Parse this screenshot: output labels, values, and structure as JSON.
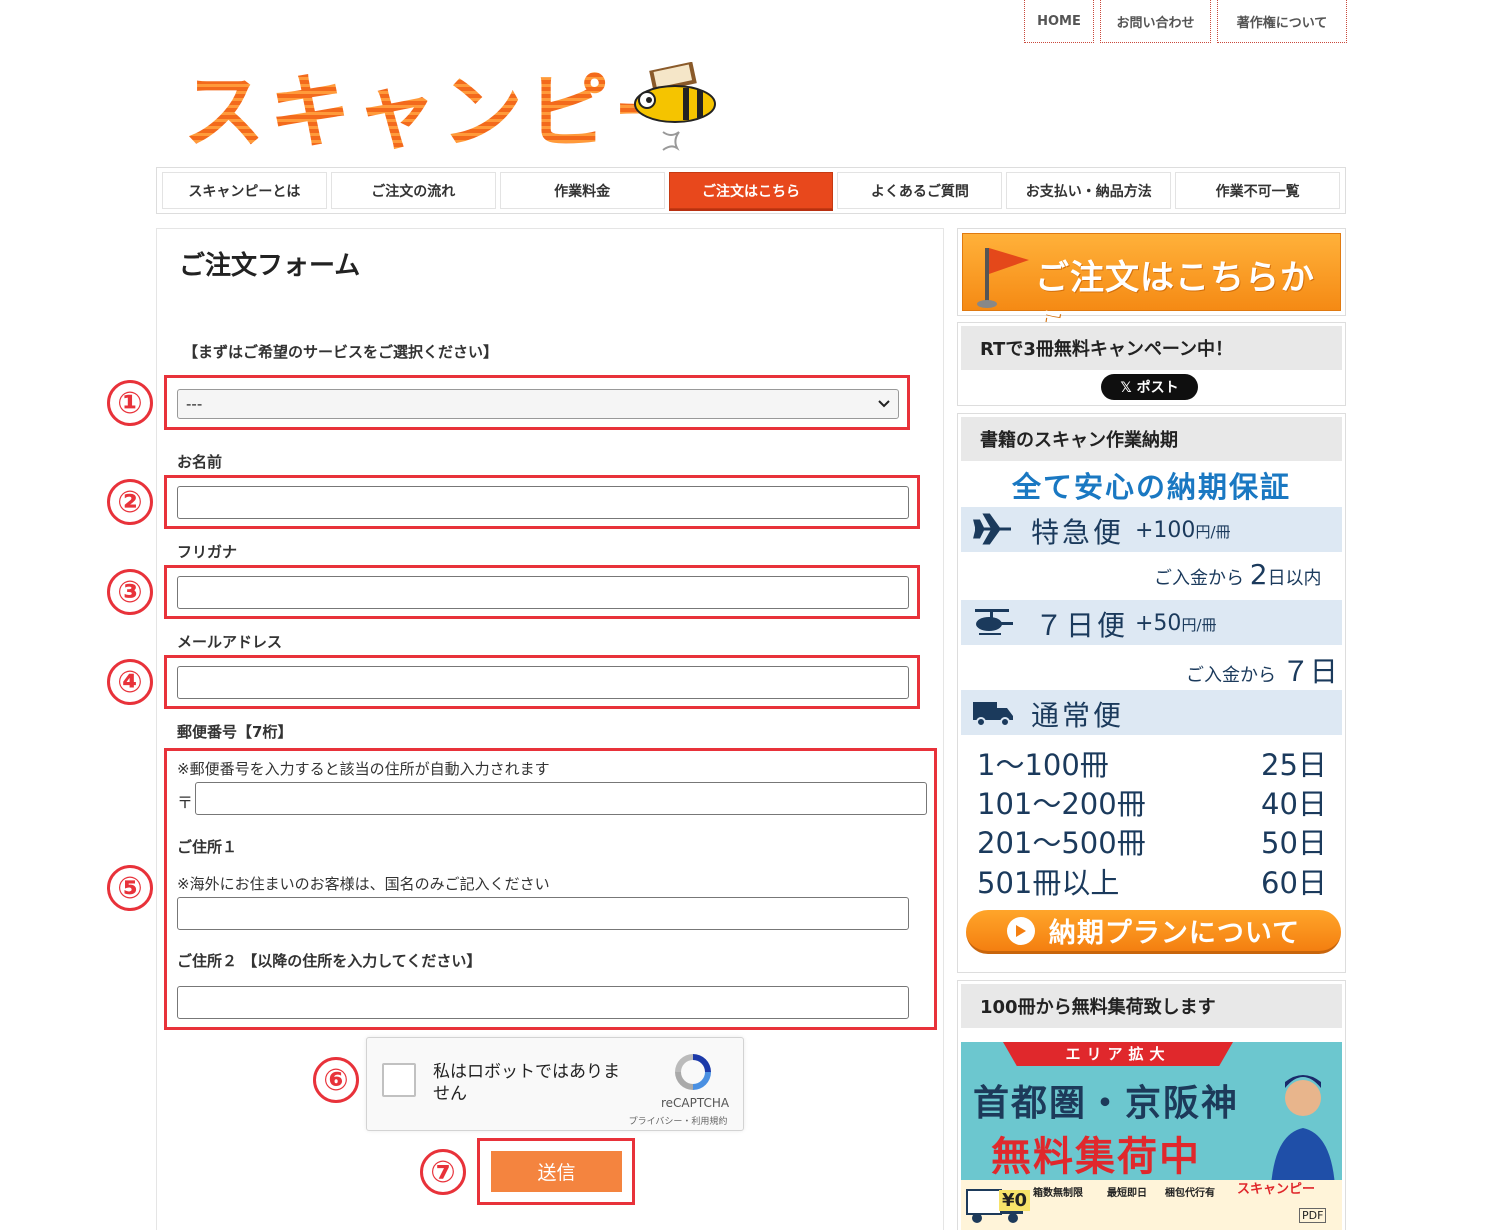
{
  "toplinks": {
    "home": "HOME",
    "contact": "お問い合わせ",
    "copyright": "著作権について"
  },
  "logo": {
    "text": "スキャンピー"
  },
  "nav": {
    "items": [
      "スキャンピーとは",
      "ご注文の流れ",
      "作業料金",
      "ご注文はこちら",
      "よくあるご質問",
      "お支払い・納品方法",
      "作業不可一覧"
    ],
    "active_index": 3
  },
  "form": {
    "title": "ご注文フォーム",
    "service_label": "【まずはご希望のサービスをご選択ください】",
    "service_value": "---",
    "name_label": "お名前",
    "furigana_label": "フリガナ",
    "email_label": "メールアドレス",
    "postal_label": "郵便番号【7桁】",
    "postal_note": "※郵便番号を入力すると該当の住所が自動入力されます",
    "postal_mark": "〒",
    "address1_label": "ご住所１",
    "address1_note": "※海外にお住まいのお客様は、国名のみご記入ください",
    "address2_label": "ご住所２ 【以降の住所を入力してください】",
    "submit_label": "送信"
  },
  "recaptcha": {
    "label": "私はロボットではありません",
    "brand": "reCAPTCHA",
    "terms": "プライバシー・利用規約"
  },
  "annotations": [
    "①",
    "②",
    "③",
    "④",
    "⑤",
    "⑥",
    "⑦"
  ],
  "sidebar": {
    "order_banner": "ご注文はこちらから",
    "campaign_title": "RTで3冊無料キャンペーン中！",
    "post_button": "𝕏 ポスト",
    "delivery_title": "書籍のスキャン作業納期",
    "delivery": {
      "headline": "全て安心の納期保証",
      "express_name": "特急便",
      "express_price": "+100",
      "express_unit": "円/冊",
      "express_sub_pre": "ご入金から",
      "express_sub_num": "2",
      "express_sub_post": "日以内",
      "week_name": "７日便",
      "week_price": "+50",
      "week_unit": "円/冊",
      "week_sub_pre": "ご入金から",
      "week_sub_num": "７日",
      "normal_name": "通常便",
      "tiers": [
        {
          "range": "1〜100冊",
          "days": "25日"
        },
        {
          "range": "101〜200冊",
          "days": "40日"
        },
        {
          "range": "201〜500冊",
          "days": "50日"
        },
        {
          "range": "501冊以上",
          "days": "60日"
        }
      ],
      "plan_button": "納期プランについて"
    },
    "pickup_title": "100冊から無料集荷致します",
    "pickup": {
      "ribbon": "エリア拡大",
      "area": "首都圏・京阪神",
      "free": "無料集荷中",
      "yen": "¥0",
      "cells": [
        "箱数無制限",
        "最短即日",
        "梱包代行有"
      ],
      "brand": "スキャンピー",
      "pdf": "PDF"
    }
  },
  "colors": {
    "accent": "#e8481c",
    "annotation": "#e8323a",
    "submit": "#f4843f",
    "plan_text": "#1b3a5c"
  }
}
